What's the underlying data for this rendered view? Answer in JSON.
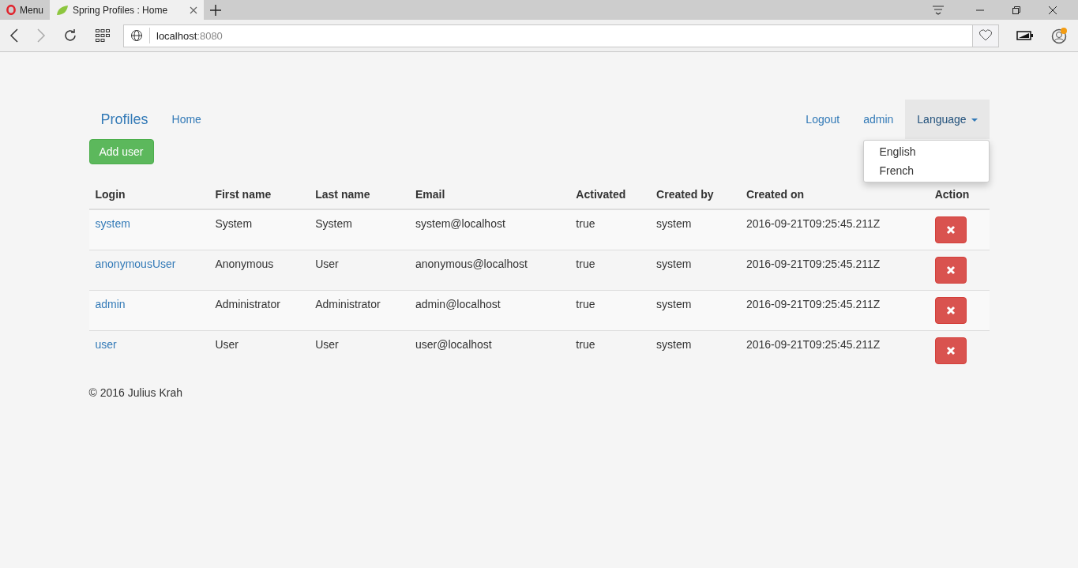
{
  "browser": {
    "menu_label": "Menu",
    "tabs": [
      {
        "title": "Spring Profiles : Home",
        "selected": true
      }
    ],
    "address": {
      "host": "localhost",
      "port": ":8080"
    }
  },
  "navbar": {
    "brand": "Profiles",
    "left_links": [
      "Home"
    ],
    "right_links": [
      "Logout",
      "admin"
    ],
    "dropdown": {
      "label": "Language",
      "expanded": true,
      "items": [
        "English",
        "French"
      ]
    }
  },
  "add_button": "Add user",
  "table": {
    "columns": [
      "Login",
      "First name",
      "Last name",
      "Email",
      "Activated",
      "Created by",
      "Created on",
      "Action"
    ],
    "rows": [
      {
        "login": "system",
        "first_name": "System",
        "last_name": "System",
        "email": "system@localhost",
        "activated": "true",
        "created_by": "system",
        "created_on": "2016-09-21T09:25:45.211Z"
      },
      {
        "login": "anonymousUser",
        "first_name": "Anonymous",
        "last_name": "User",
        "email": "anonymous@localhost",
        "activated": "true",
        "created_by": "system",
        "created_on": "2016-09-21T09:25:45.211Z"
      },
      {
        "login": "admin",
        "first_name": "Administrator",
        "last_name": "Administrator",
        "email": "admin@localhost",
        "activated": "true",
        "created_by": "system",
        "created_on": "2016-09-21T09:25:45.211Z"
      },
      {
        "login": "user",
        "first_name": "User",
        "last_name": "User",
        "email": "user@localhost",
        "activated": "true",
        "created_by": "system",
        "created_on": "2016-09-21T09:25:45.211Z"
      }
    ]
  },
  "footer": "© 2016 Julius Krah"
}
